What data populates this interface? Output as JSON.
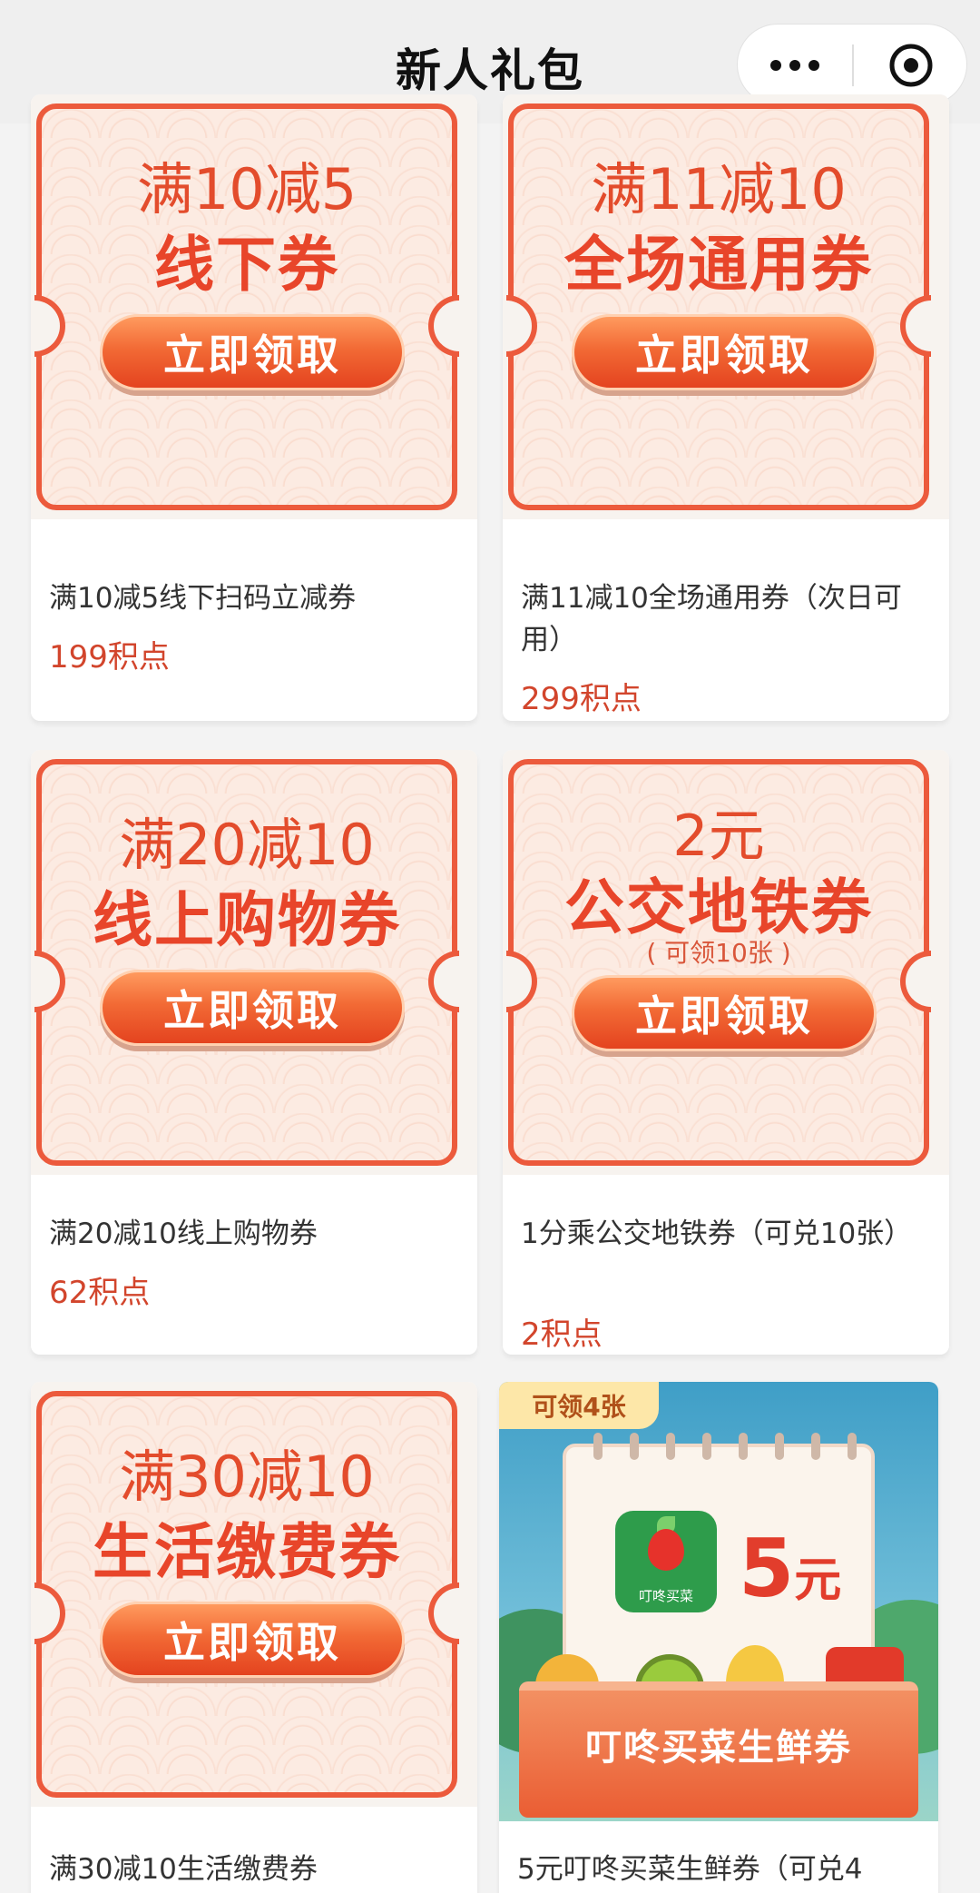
{
  "nav": {
    "title": "新人礼包",
    "more_icon": "more-dots-icon",
    "close_icon": "close-circle-icon"
  },
  "colors": {
    "accent": "#e8452a",
    "points": "#d2452c",
    "button_gradient_top": "#ff9a5e",
    "button_gradient_bottom": "#e4431f"
  },
  "claim_label": "立即领取",
  "items": [
    {
      "coupon_line1": "满10减5",
      "coupon_line2": "线下券",
      "title": "满10减5线下扫码立减券",
      "points": "199积点"
    },
    {
      "coupon_line1": "满11减10",
      "coupon_line2": "全场通用券",
      "title": "满11减10全场通用券（次日可用）",
      "points": "299积点"
    },
    {
      "coupon_line1": "满20减10",
      "coupon_line2": "线上购物券",
      "title": "满20减10线上购物券",
      "points": "62积点"
    },
    {
      "coupon_line1": "2元",
      "coupon_line2": "公交地铁券",
      "coupon_note": "( 可领10张 )",
      "title": "1分乘公交地铁券（可兑10张）",
      "points": "2积点"
    },
    {
      "coupon_line1": "满30减10",
      "coupon_line2": "生活缴费券",
      "title": "满30减10生活缴费券"
    },
    {
      "tag": "可领4张",
      "app_name": "叮咚买菜",
      "amount": "5",
      "amount_unit": "元",
      "basket_label": "叮咚买菜生鲜券",
      "title": "5元叮咚买菜生鲜券（可兑4"
    }
  ]
}
